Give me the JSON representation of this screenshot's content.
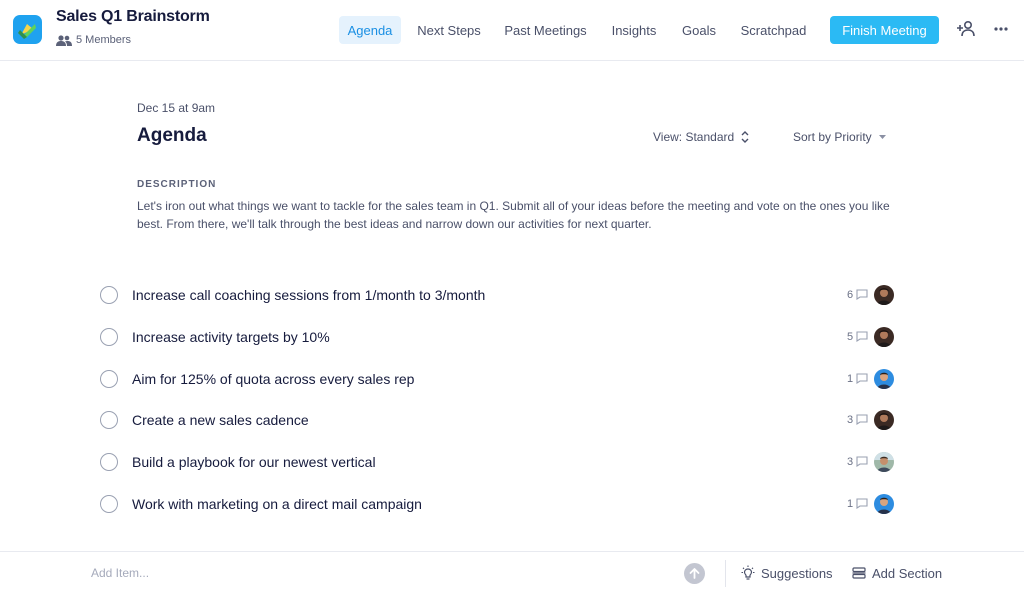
{
  "header": {
    "title": "Sales Q1 Brainstorm",
    "members": "5 Members",
    "tabs": [
      {
        "label": "Agenda",
        "active": true
      },
      {
        "label": "Next Steps",
        "active": false
      },
      {
        "label": "Past Meetings",
        "active": false
      },
      {
        "label": "Insights",
        "active": false
      },
      {
        "label": "Goals",
        "active": false
      },
      {
        "label": "Scratchpad",
        "active": false
      }
    ],
    "finish_button": "Finish Meeting",
    "icons": {
      "logo": "app-logo-icon",
      "members": "people-icon",
      "add_person": "add-person-icon",
      "more": "more-icon"
    }
  },
  "main": {
    "date": "Dec 15 at 9am",
    "heading": "Agenda",
    "view_select": "View: Standard",
    "sort_select": "Sort by Priority",
    "description_label": "DESCRIPTION",
    "description": "Let's iron out what things we want to tackle for the sales team in Q1. Submit all of your ideas before the meeting and vote on the ones you like best. From there, we'll talk through the best ideas and narrow down our activities for next quarter."
  },
  "items": [
    {
      "text": "Increase call coaching sessions from 1/month to 3/month",
      "comments": "6",
      "avatar": "avatar-dark"
    },
    {
      "text": "Increase activity targets by 10%",
      "comments": "5",
      "avatar": "avatar-dark"
    },
    {
      "text": "Aim for 125% of quota across every sales rep",
      "comments": "1",
      "avatar": "avatar-blue"
    },
    {
      "text": "Create a new sales cadence",
      "comments": "3",
      "avatar": "avatar-dark"
    },
    {
      "text": "Build a playbook for our newest vertical",
      "comments": "3",
      "avatar": "avatar-outdoor"
    },
    {
      "text": "Work with marketing on a direct mail campaign",
      "comments": "1",
      "avatar": "avatar-blue"
    }
  ],
  "footer": {
    "add_item_placeholder": "Add Item...",
    "suggestions": "Suggestions",
    "add_section": "Add Section"
  },
  "colors": {
    "accent": "#2bbaf4",
    "active_tab_bg": "#e5f2fd",
    "active_tab_text": "#1a8fe3",
    "text_dark": "#161b3d"
  }
}
